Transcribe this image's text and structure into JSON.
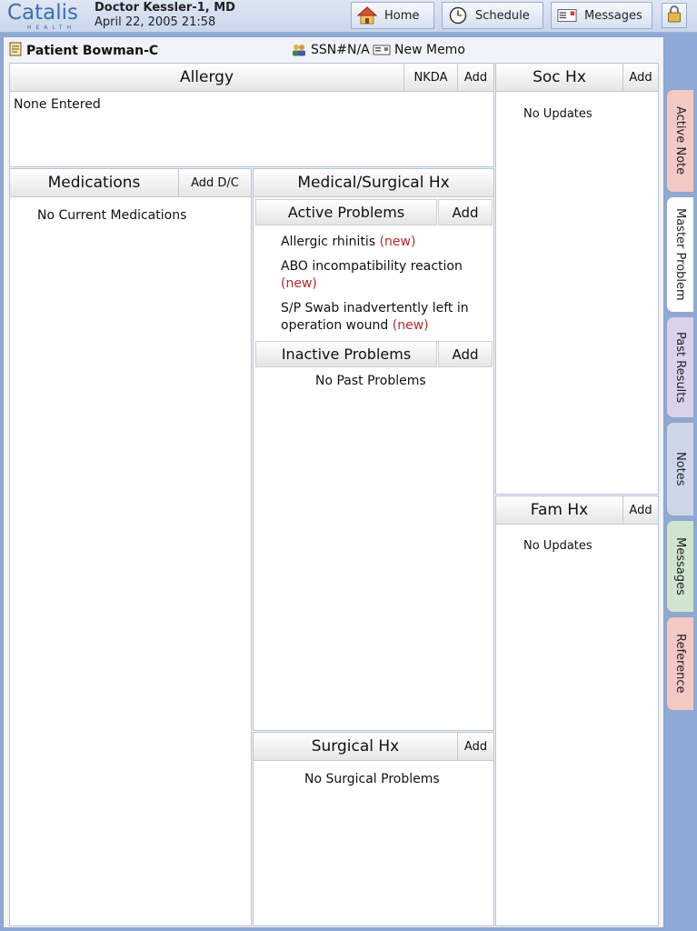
{
  "app": {
    "logo_text": "Catalis",
    "logo_sub": "HEALTH",
    "doctor_name": "Doctor Kessler-1, MD",
    "datetime": "April 22, 2005 21:58"
  },
  "nav": {
    "home": "Home",
    "schedule": "Schedule",
    "messages": "Messages"
  },
  "patient": {
    "name": "Patient Bowman-C",
    "ssn": "SSN#N/A",
    "new_memo": "New Memo"
  },
  "allergy": {
    "title": "Allergy",
    "nkda": "NKDA",
    "add": "Add",
    "empty": "None Entered"
  },
  "soc_hx": {
    "title": "Soc Hx",
    "add": "Add",
    "empty": "No Updates"
  },
  "medications": {
    "title": "Medications",
    "add": "Add D/C",
    "empty": "No Current Medications"
  },
  "medical_surgical": {
    "title": "Medical/Surgical Hx",
    "active_title": "Active Problems",
    "active_add": "Add",
    "active_problems": [
      {
        "text": "Allergic rhinitis",
        "flag": "(new)"
      },
      {
        "text": "ABO incompatibility reaction",
        "flag": "(new)"
      },
      {
        "text": "S/P Swab inadvertently left in operation wound",
        "flag": "(new)"
      }
    ],
    "inactive_title": "Inactive Problems",
    "inactive_add": "Add",
    "inactive_empty": "No Past Problems"
  },
  "surgical_hx": {
    "title": "Surgical Hx",
    "add": "Add",
    "empty": "No Surgical Problems"
  },
  "fam_hx": {
    "title": "Fam Hx",
    "add": "Add",
    "empty": "No Updates"
  },
  "tabs": [
    {
      "label": "Active Note",
      "color": "#f2c9c4"
    },
    {
      "label": "Master Problem",
      "color": "#ffffff"
    },
    {
      "label": "Past Results",
      "color": "#dcd0ea"
    },
    {
      "label": "Notes",
      "color": "#cdd7ea"
    },
    {
      "label": "Messages",
      "color": "#cfe5cf"
    },
    {
      "label": "Reference",
      "color": "#f2c9c4"
    }
  ],
  "colors": {
    "accent": "#3a6db5",
    "new_flag": "#c0282a",
    "background": "#8ea9d6"
  }
}
